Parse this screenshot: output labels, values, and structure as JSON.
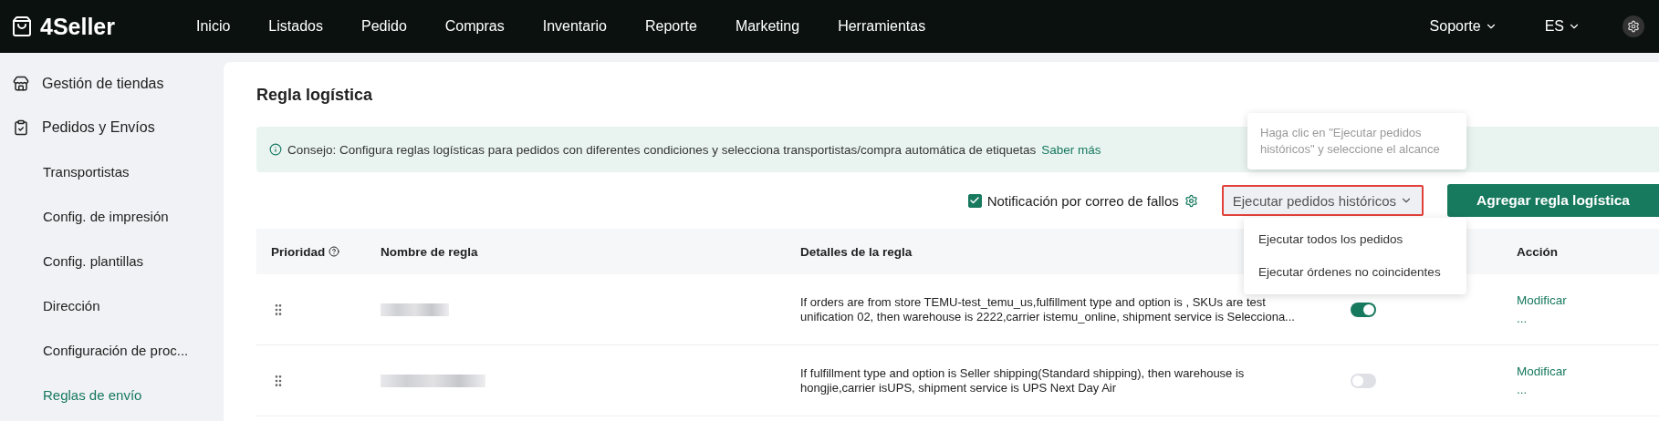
{
  "topbar": {
    "logo": "4Seller",
    "nav": [
      {
        "label": "Inicio"
      },
      {
        "label": "Listados"
      },
      {
        "label": "Pedido"
      },
      {
        "label": "Compras"
      },
      {
        "label": "Inventario"
      },
      {
        "label": "Reporte"
      },
      {
        "label": "Marketing"
      },
      {
        "label": "Herramientas"
      }
    ],
    "support": "Soporte",
    "language": "ES"
  },
  "sidebar": {
    "groups": [
      {
        "label": "Gestión de tiendas"
      },
      {
        "label": "Pedidos y Envíos",
        "children": [
          {
            "label": "Transportistas",
            "selected": false
          },
          {
            "label": "Config. de impresión",
            "selected": false
          },
          {
            "label": "Config. plantillas",
            "selected": false
          },
          {
            "label": "Dirección",
            "selected": false
          },
          {
            "label": "Configuración de proc...",
            "selected": false
          },
          {
            "label": "Reglas de envío",
            "selected": true
          }
        ]
      }
    ]
  },
  "page": {
    "title": "Regla logística",
    "tip": "Consejo: Configura reglas logísticas para pedidos con diferentes condiciones y selecciona transportistas/compra automática de etiquetas",
    "tip_link": "Saber más",
    "notify": {
      "label": "Notificación por correo de fallos",
      "checked": true
    },
    "run_button": "Ejecutar pedidos históricos",
    "tooltip": "Haga clic en \"Ejecutar pedidos históricos\" y seleccione el alcance",
    "run_menu": [
      {
        "label": "Ejecutar todos los pedidos"
      },
      {
        "label": "Ejecutar órdenes no coincidentes"
      }
    ],
    "add_button": "Agregar regla logística"
  },
  "table": {
    "columns": [
      "Prioridad",
      "Nombre de regla",
      "Detalles de la regla",
      "",
      "Acción"
    ],
    "rows": [
      {
        "details": "If orders are from store TEMU-test_temu_us,fulfillment type and option is , SKUs are test unification 02, then warehouse is 2222,carrier istemu_online, shipment service is Selecciona...",
        "on": true,
        "action": "Modificar",
        "more": "..."
      },
      {
        "details": "If fulfillment type and option is Seller shipping(Standard shipping), then warehouse is hongjie,carrier isUPS, shipment service is UPS Next Day Air",
        "on": false,
        "action": "Modificar",
        "more": "..."
      }
    ]
  }
}
